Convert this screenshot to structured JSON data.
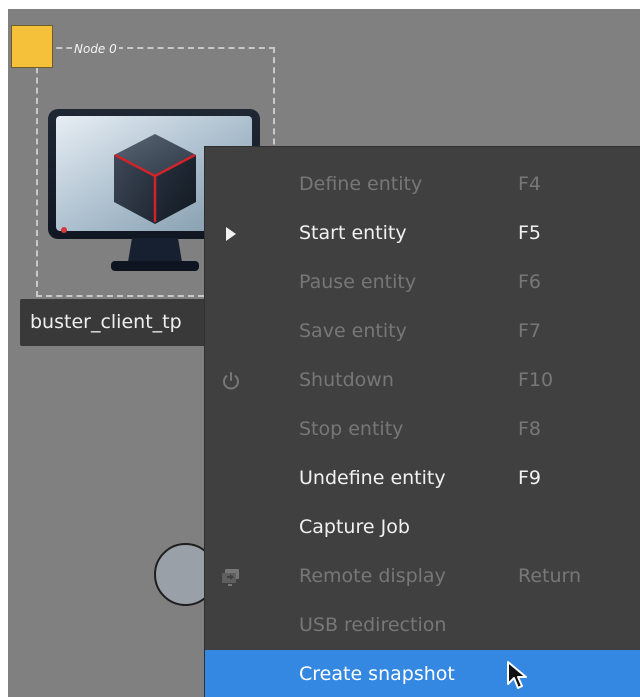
{
  "canvas": {
    "background": "#808080",
    "node_label": "Node 0",
    "node_badge_color": "#f5c13a",
    "client_label": "buster_client_tp"
  },
  "context_menu": {
    "items": [
      {
        "label": "Define entity",
        "shortcut": "F4",
        "enabled": false,
        "selected": false,
        "icon": ""
      },
      {
        "label": "Start entity",
        "shortcut": "F5",
        "enabled": true,
        "selected": false,
        "icon": "play-icon"
      },
      {
        "label": "Pause entity",
        "shortcut": "F6",
        "enabled": false,
        "selected": false,
        "icon": ""
      },
      {
        "label": "Save entity",
        "shortcut": "F7",
        "enabled": false,
        "selected": false,
        "icon": ""
      },
      {
        "label": "Shutdown",
        "shortcut": "F10",
        "enabled": false,
        "selected": false,
        "icon": "power-icon"
      },
      {
        "label": "Stop entity",
        "shortcut": "F8",
        "enabled": false,
        "selected": false,
        "icon": ""
      },
      {
        "label": "Undefine entity",
        "shortcut": "F9",
        "enabled": true,
        "selected": false,
        "icon": ""
      },
      {
        "label": "Capture Job",
        "shortcut": "",
        "enabled": true,
        "selected": false,
        "icon": ""
      },
      {
        "label": "Remote display",
        "shortcut": "Return",
        "enabled": false,
        "selected": false,
        "icon": "remote-display-icon"
      },
      {
        "label": "USB redirection",
        "shortcut": "",
        "enabled": false,
        "selected": false,
        "icon": ""
      },
      {
        "label": "Create snapshot",
        "shortcut": "",
        "enabled": true,
        "selected": true,
        "icon": ""
      }
    ],
    "colors": {
      "background": "#404040",
      "selected": "#3488e2",
      "enabled_text": "#f1f1f1",
      "disabled_text": "#777777"
    }
  }
}
